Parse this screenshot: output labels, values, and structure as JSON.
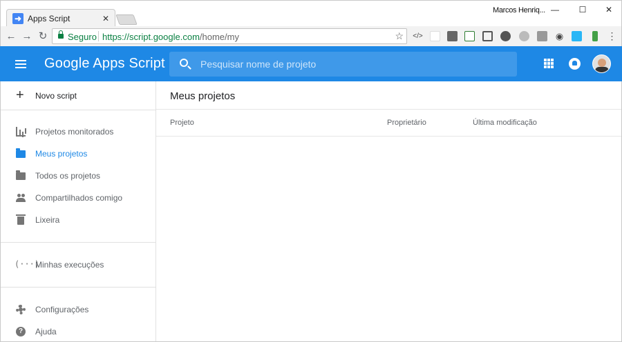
{
  "browser": {
    "tab_title": "Apps Script",
    "tab_close": "✕",
    "user_name": "Marcos Henriq...",
    "window_controls": {
      "minimize": "—",
      "maximize": "☐",
      "close": "✕"
    },
    "security_label": "Seguro",
    "url_host": "https://script.google.com",
    "url_path": "/home/my",
    "extensions": [
      "code-icon",
      "page-icon",
      "note-icon",
      "sheets-icon",
      "fullscreen-icon",
      "gear-ext-icon",
      "ext-icon",
      "pdf-icon",
      "eye-icon",
      "plus-ext-icon",
      "battery-icon",
      "menu-dots-icon"
    ]
  },
  "appbar": {
    "title": "Google Apps Script",
    "search_placeholder": "Pesquisar nome de projeto",
    "accent_color": "#1e88e5"
  },
  "sidebar": {
    "new_script_label": "Novo script",
    "items": [
      {
        "label": "Projetos monitorados",
        "icon": "monitoring-icon",
        "active": false
      },
      {
        "label": "Meus projetos",
        "icon": "folder-icon",
        "active": true
      },
      {
        "label": "Todos os projetos",
        "icon": "folder-icon",
        "active": false
      },
      {
        "label": "Compartilhados comigo",
        "icon": "people-icon",
        "active": false
      },
      {
        "label": "Lixeira",
        "icon": "trash-icon",
        "active": false
      }
    ],
    "executions_label": "Minhas execuções",
    "executions_icon": "(···)",
    "settings_label": "Configurações",
    "help_label": "Ajuda",
    "help_icon": "?"
  },
  "main": {
    "title": "Meus projetos",
    "columns": [
      "Projeto",
      "Proprietário",
      "Última modificação"
    ]
  }
}
